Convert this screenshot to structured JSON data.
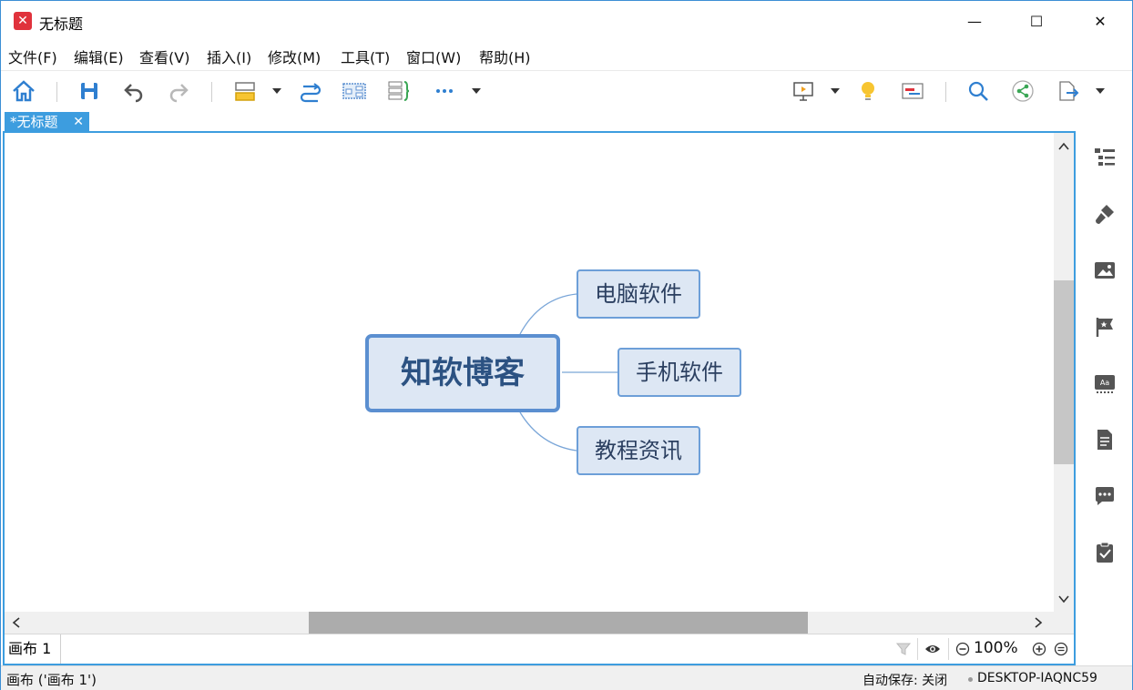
{
  "window": {
    "title": "无标题",
    "logo_glyph": "✕",
    "controls": {
      "minimize": "—",
      "maximize": "☐",
      "close": "✕"
    }
  },
  "menu": [
    "文件(F)",
    "编辑(E)",
    "查看(V)",
    "插入(I)",
    "修改(M)",
    "工具(T)",
    "窗口(W)",
    "帮助(H)"
  ],
  "toolbar": {
    "icons": [
      "home-icon",
      "save-icon",
      "undo-icon",
      "redo-icon",
      "topic-style-icon",
      "relationship-icon",
      "boundary-icon",
      "summary-icon",
      "more-icon",
      "presentation-icon",
      "brainstorm-icon",
      "gantt-icon",
      "search-icon",
      "share-icon",
      "export-icon"
    ]
  },
  "doc_tab": {
    "label": "*无标题",
    "close": "✕"
  },
  "mindmap": {
    "central": "知软博客",
    "branches": [
      "电脑软件",
      "手机软件",
      "教程资讯"
    ]
  },
  "sheetbar": {
    "sheet_label": "画布 1",
    "zoom": "100%"
  },
  "sidebar": {
    "icons": [
      "outline-icon",
      "format-brush-icon",
      "image-icon",
      "marker-flag-icon",
      "text-style-icon",
      "notes-icon",
      "comment-icon",
      "task-icon"
    ]
  },
  "status": {
    "left": "画布 ('画布 1')",
    "autosave": "自动保存: 关闭",
    "host": "DESKTOP-IAQNC59"
  },
  "colors": {
    "accent": "#3d9ddf",
    "topic_fill": "#dde7f4",
    "topic_border": "#6d9fd8",
    "central_text": "#2c5282"
  }
}
